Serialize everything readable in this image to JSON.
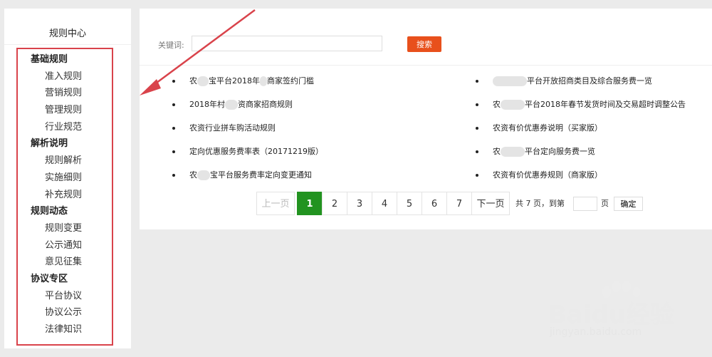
{
  "sidebar": {
    "title": "规则中心",
    "groups": [
      {
        "heading": "基础规则",
        "items": [
          "准入规则",
          "营销规则",
          "管理规则",
          "行业规范"
        ]
      },
      {
        "heading": "解析说明",
        "items": [
          "规则解析",
          "实施细则",
          "补充规则"
        ]
      },
      {
        "heading": "规则动态",
        "items": [
          "规则变更",
          "公示通知",
          "意见征集"
        ]
      },
      {
        "heading": "协议专区",
        "items": [
          "平台协议",
          "协议公示",
          "法律知识"
        ]
      }
    ]
  },
  "search": {
    "label": "关键词:",
    "value": "",
    "button": "搜索"
  },
  "rules": {
    "left": [
      {
        "pre": "农",
        "post": "宝平台2018年",
        "post2": "商家签约门槛"
      },
      {
        "pre": "2018年村",
        "post": "资商家招商规则",
        "post2": ""
      },
      {
        "pre": "农资行业拼车购活动规则",
        "post": "",
        "post2": ""
      },
      {
        "pre": "定向优惠服务费率表（20171219版）",
        "post": "",
        "post2": ""
      },
      {
        "pre": "农",
        "post": "宝平台服务费率定向变更通知",
        "post2": ""
      }
    ],
    "right": [
      {
        "pre": "",
        "post": "平台开放招商类目及综合服务费一览",
        "post2": ""
      },
      {
        "pre": "农",
        "post": "平台2018年春节发货时间及交易超时调整公告",
        "post2": ""
      },
      {
        "pre": "农资有价优惠券说明（买家版）",
        "post": "",
        "post2": ""
      },
      {
        "pre": "农",
        "post": "平台定向服务费一览",
        "post2": ""
      },
      {
        "pre": "农资有价优惠券规则（商家版）",
        "post": "",
        "post2": ""
      }
    ]
  },
  "pagination": {
    "prev": "上一页",
    "pages": [
      "1",
      "2",
      "3",
      "4",
      "5",
      "6",
      "7"
    ],
    "current": "1",
    "next": "下一页",
    "total_text": "共 7 页，到第",
    "unit": "页",
    "confirm": "确定"
  },
  "watermark": {
    "logo": "Baidu经验",
    "url": "jingyan.baidu.com"
  },
  "colors": {
    "accent": "#e8501c",
    "active_page": "#229320",
    "highlight_box": "#d9434b",
    "arrow": "#d9434b"
  }
}
